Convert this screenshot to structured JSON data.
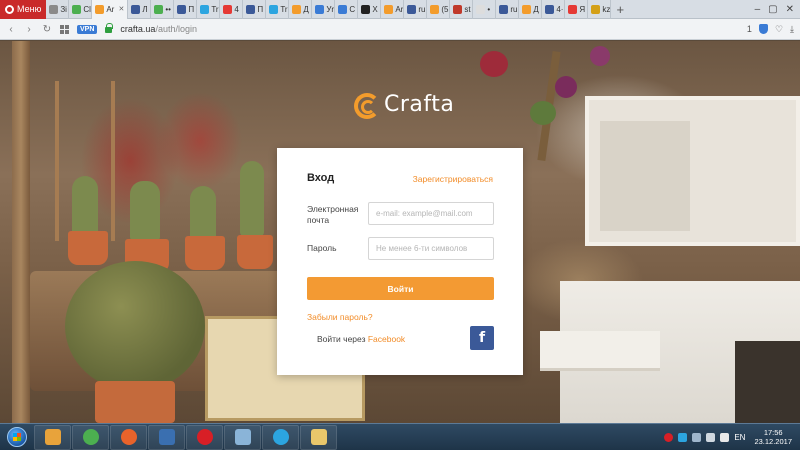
{
  "browser": {
    "menu_label": "Меню",
    "active_tab_label": "Ar",
    "tabs": [
      {
        "label": "Зі",
        "color": "#8a8a8a"
      },
      {
        "label": "Cl",
        "color": "#4caf50"
      },
      {
        "label": "Ar",
        "color": "#f39c2c",
        "active": true
      },
      {
        "label": "Л",
        "color": "#3b5998"
      },
      {
        "label": "••",
        "color": "#4caf50"
      },
      {
        "label": "П",
        "color": "#3b5998"
      },
      {
        "label": "Tr",
        "color": "#2ca5e0"
      },
      {
        "label": "4",
        "color": "#e53935"
      },
      {
        "label": "П",
        "color": "#3b5998"
      },
      {
        "label": "Tr",
        "color": "#2ca5e0"
      },
      {
        "label": "Д",
        "color": "#f39c2c"
      },
      {
        "label": "Уr",
        "color": "#3a7bd5"
      },
      {
        "label": "С",
        "color": "#3a7bd5"
      },
      {
        "label": "Х",
        "color": "#222222"
      },
      {
        "label": "Ar",
        "color": "#f39c2c"
      },
      {
        "label": "ru",
        "color": "#3b5998"
      },
      {
        "label": "(5",
        "color": "#f39c2c"
      },
      {
        "label": "st",
        "color": "#c0392b"
      },
      {
        "label": "•",
        "color": "#dddddd"
      },
      {
        "label": "ru",
        "color": "#3b5998"
      },
      {
        "label": "Д",
        "color": "#f39c2c"
      },
      {
        "label": "4·",
        "color": "#3b5998"
      },
      {
        "label": "Я",
        "color": "#e53935"
      },
      {
        "label": "kz",
        "color": "#d4a017"
      }
    ],
    "vpn_label": "VPN",
    "url_host": "crafta.ua",
    "url_path": "/auth/login",
    "addr_badge": "1"
  },
  "logo": {
    "text": "Crafta",
    "accent": "#f39c2c"
  },
  "login": {
    "title": "Вход",
    "register_link": "Зарегистрироваться",
    "email_label": "Электронная почта",
    "email_placeholder": "e-mail: example@mail.com",
    "password_label": "Пароль",
    "password_placeholder": "Не менее 6-ти символов",
    "submit_label": "Войти",
    "forgot_link": "Забыли пароль?",
    "facebook_prefix": "Войти через",
    "facebook_link": "Facebook",
    "facebook_icon_letter": "f"
  },
  "taskbar": {
    "apps": [
      {
        "name": "media-player",
        "color": "#e8a33b"
      },
      {
        "name": "chrome",
        "color": "#4caf50"
      },
      {
        "name": "firefox",
        "color": "#e8632b"
      },
      {
        "name": "save",
        "color": "#3a6fb0"
      },
      {
        "name": "opera",
        "color": "#d81f26"
      },
      {
        "name": "network",
        "color": "#8ab4d8"
      },
      {
        "name": "telegram",
        "color": "#2ca5e0"
      },
      {
        "name": "explorer",
        "color": "#e9c76b"
      }
    ],
    "lang": "EN",
    "time": "17:56",
    "date": "23.12.2017"
  }
}
